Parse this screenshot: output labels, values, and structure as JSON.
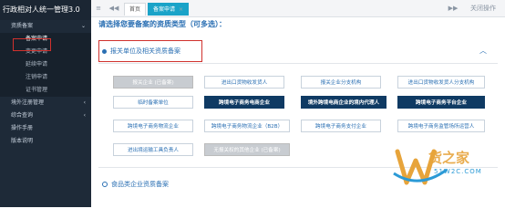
{
  "app_title": "行政相对人统一管理3.0",
  "sidebar": {
    "groups": [
      {
        "label": "资质备案",
        "expanded": true,
        "items": [
          "备案申请",
          "变更申请",
          "延续申请",
          "注销申请",
          "证书管理"
        ]
      },
      {
        "label": "境外注册管理"
      },
      {
        "label": "综合查询"
      },
      {
        "label": "操作手册"
      },
      {
        "label": "版本说明"
      }
    ]
  },
  "topbar": {
    "menu_icon": "≡",
    "prev_icon": "◀◀",
    "tabs": [
      {
        "label": "首页"
      },
      {
        "label": "备案申请"
      }
    ],
    "next_icon": "▶▶",
    "close_label": "关闭操作"
  },
  "main": {
    "title": "请选择您要备案的资质类型（可多选）：",
    "section1": "报关单位及相关资质备案",
    "section2": "食品类企业资质备案",
    "buttons": [
      {
        "label": "报关企业 (已备案)",
        "style": "gray"
      },
      {
        "label": "进出口货物收发货人",
        "style": "normal"
      },
      {
        "label": "报关企业分支机构",
        "style": "normal"
      },
      {
        "label": "进出口货物收发货人分支机构",
        "style": "normal"
      },
      {
        "label": "临时备案单位",
        "style": "normal"
      },
      {
        "label": "跨境电子商务电商企业",
        "style": "dark"
      },
      {
        "label": "境外跨境电商企业的境内代理人",
        "style": "dark"
      },
      {
        "label": "跨境电子商务平台企业",
        "style": "dark"
      },
      {
        "label": "跨境电子商务物流企业",
        "style": "normal"
      },
      {
        "label": "跨境电子商务物流企业（B2B）",
        "style": "normal"
      },
      {
        "label": "跨境电子商务支付企业",
        "style": "normal"
      },
      {
        "label": "跨境电子商务监管场所运营人",
        "style": "normal"
      },
      {
        "label": "进出境运输工具负责人",
        "style": "normal"
      },
      {
        "label": "无报关权的其他企业 (已备案)",
        "style": "gray"
      }
    ]
  },
  "watermark": {
    "text": "货之家",
    "sub": "51W2C.COM"
  }
}
